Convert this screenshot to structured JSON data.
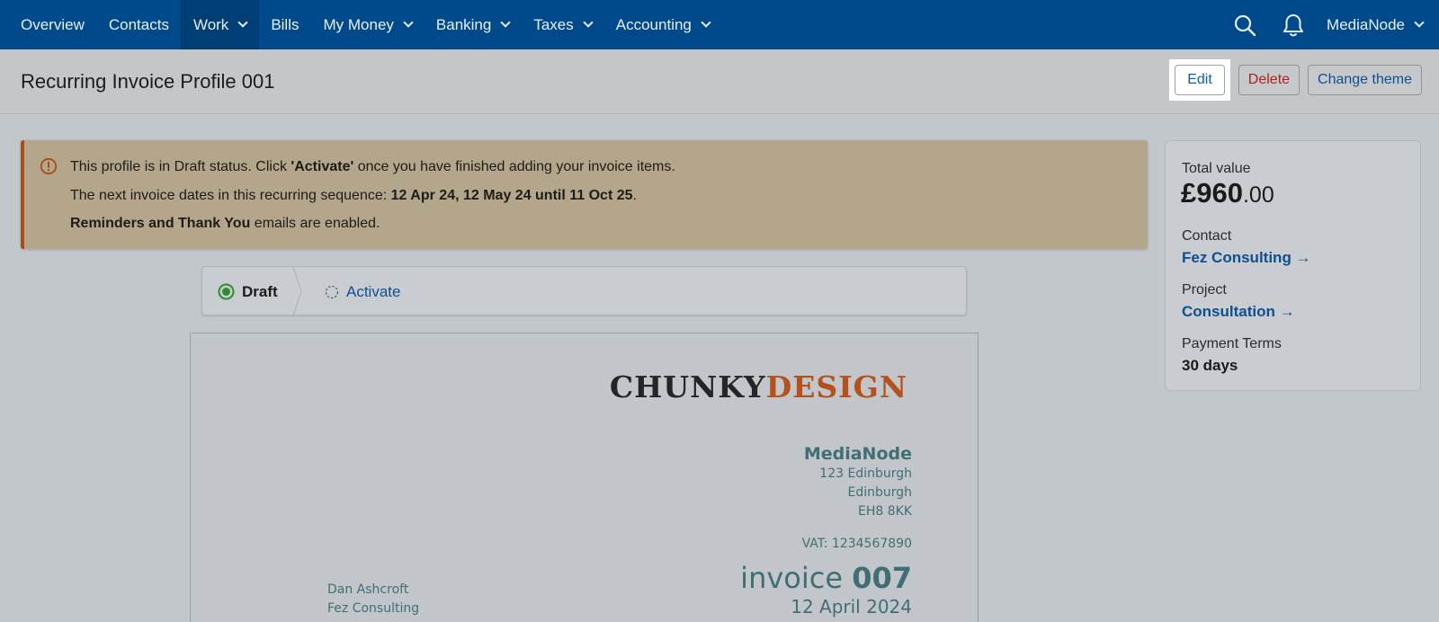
{
  "nav": {
    "items": [
      {
        "label": "Overview",
        "dropdown": false,
        "active": false
      },
      {
        "label": "Contacts",
        "dropdown": false,
        "active": false
      },
      {
        "label": "Work",
        "dropdown": true,
        "active": true
      },
      {
        "label": "Bills",
        "dropdown": false,
        "active": false
      },
      {
        "label": "My Money",
        "dropdown": true,
        "active": false
      },
      {
        "label": "Banking",
        "dropdown": true,
        "active": false
      },
      {
        "label": "Taxes",
        "dropdown": true,
        "active": false
      },
      {
        "label": "Accounting",
        "dropdown": true,
        "active": false
      }
    ],
    "account_label": "MediaNode",
    "search_icon": "search-icon",
    "notifications_icon": "bell-icon"
  },
  "header": {
    "title": "Recurring Invoice Profile 001",
    "edit_label": "Edit",
    "delete_label": "Delete",
    "theme_label": "Change theme"
  },
  "alert": {
    "icon": "warning-circle-icon",
    "line1_pre": "This profile is in Draft status. Click ",
    "line1_bold": "'Activate'",
    "line1_post": " once you have finished adding your invoice items.",
    "line2_pre": "The next invoice dates in this recurring sequence: ",
    "line2_bold": "12 Apr 24, 12 May 24 until 11 Oct 25",
    "line2_post": ".",
    "line3_bold": "Reminders and Thank You",
    "line3_post": " emails are enabled."
  },
  "steps": {
    "draft_label": "Draft",
    "activate_label": "Activate"
  },
  "invoice": {
    "logo_part1": "CHUNKY",
    "logo_part2": "DESIGN",
    "company_name": "MediaNode",
    "address": [
      "123 Edinburgh",
      "Edinburgh",
      "EH8 8KK"
    ],
    "vat": "VAT: 1234567890",
    "bill_to": [
      "Dan Ashcroft",
      "Fez Consulting"
    ],
    "title_word": "invoice",
    "number": "007",
    "date": "12 April 2024"
  },
  "summary": {
    "total_label": "Total value",
    "total_main": "£960",
    "total_decimal": ".00",
    "contact_label": "Contact",
    "contact_link": "Fez Consulting →",
    "project_label": "Project",
    "project_link": "Consultation →",
    "terms_label": "Payment Terms",
    "terms_value": "30 days"
  },
  "colors": {
    "nav_bg": "#004a8c",
    "alert_accent": "#a94d14",
    "link": "#0f4f8f",
    "delete": "#b0201c",
    "draft_status": "#2e8b2e"
  }
}
